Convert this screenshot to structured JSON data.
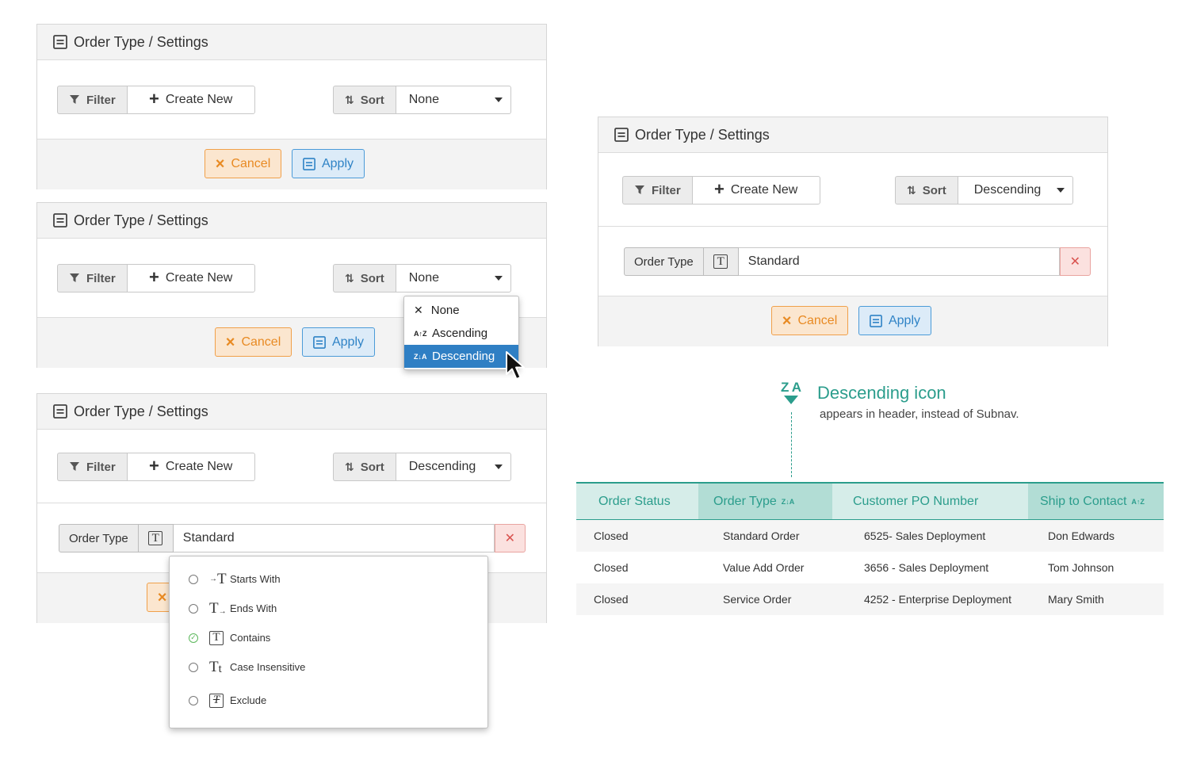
{
  "panel_title": "Order Type / Settings",
  "filter_label": "Filter",
  "create_new_label": "Create New",
  "sort_label": "Sort",
  "cancel_label": "Cancel",
  "apply_label": "Apply",
  "panels": [
    {
      "sort_value": "None"
    },
    {
      "sort_value": "None"
    },
    {
      "sort_value": "Descending",
      "filter_field": "Order Type",
      "filter_value": "Standard"
    },
    {
      "sort_value": "Descending",
      "filter_field": "Order Type",
      "filter_value": "Standard"
    }
  ],
  "sort_dropdown": {
    "options": [
      "None",
      "Ascending",
      "Descending"
    ],
    "selected": "Descending"
  },
  "filter_options": [
    {
      "label": "Starts With",
      "checked": false
    },
    {
      "label": "Ends With",
      "checked": false
    },
    {
      "label": "Contains",
      "checked": true
    },
    {
      "label": "Case Insensitive",
      "checked": false
    },
    {
      "label": "Exclude",
      "checked": false
    }
  ],
  "annotation": {
    "icon_text": "Z A",
    "title": "Descending icon",
    "subtitle": "appears in header, instead of Subnav."
  },
  "table": {
    "headers": [
      "Order Status",
      "Order Type",
      "Customer PO Number",
      "Ship to Contact"
    ],
    "rows": [
      [
        "Closed",
        "Standard Order",
        "6525- Sales Deployment",
        "Don Edwards"
      ],
      [
        "Closed",
        "Value Add Order",
        "3656 - Sales Deployment",
        "Tom Johnson"
      ],
      [
        "Closed",
        "Service Order",
        "4252 - Enterprise Deployment",
        "Mary Smith"
      ]
    ]
  },
  "colors": {
    "accent_teal": "#2b9d8c",
    "apply_blue": "#2f83c6",
    "cancel_orange": "#e88a23",
    "selected_blue": "#2f7fc4"
  }
}
